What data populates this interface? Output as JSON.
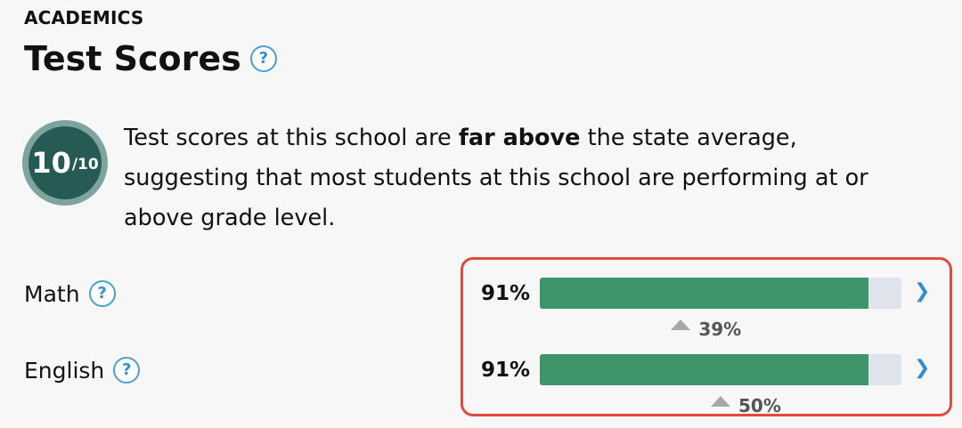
{
  "section": "ACADEMICS",
  "title": "Test Scores",
  "help_glyph": "?",
  "rating": {
    "score": "10",
    "denominator": "/10"
  },
  "summary": {
    "before": "Test scores at this school are ",
    "emphasis": "far above",
    "after": " the state average, suggesting that most students at this school are performing at or above grade level."
  },
  "subjects": [
    {
      "name": "Math",
      "score_label": "91%",
      "score_fraction": 0.91,
      "state_avg_label": "39%",
      "state_avg_fraction": 0.39
    },
    {
      "name": "English",
      "score_label": "91%",
      "score_fraction": 0.91,
      "state_avg_label": "50%",
      "state_avg_fraction": 0.5
    }
  ],
  "icons": {
    "help": "question-circle-icon",
    "chevron": "chevron-right-icon",
    "marker": "triangle-up-icon"
  },
  "colors": {
    "bar_fill": "#3f956a",
    "bar_track": "#dfe3ec",
    "rating_ring": "#7fa39f",
    "rating_core": "#255a55",
    "highlight_border": "#e14a3c",
    "link_blue": "#2f8fd0"
  }
}
